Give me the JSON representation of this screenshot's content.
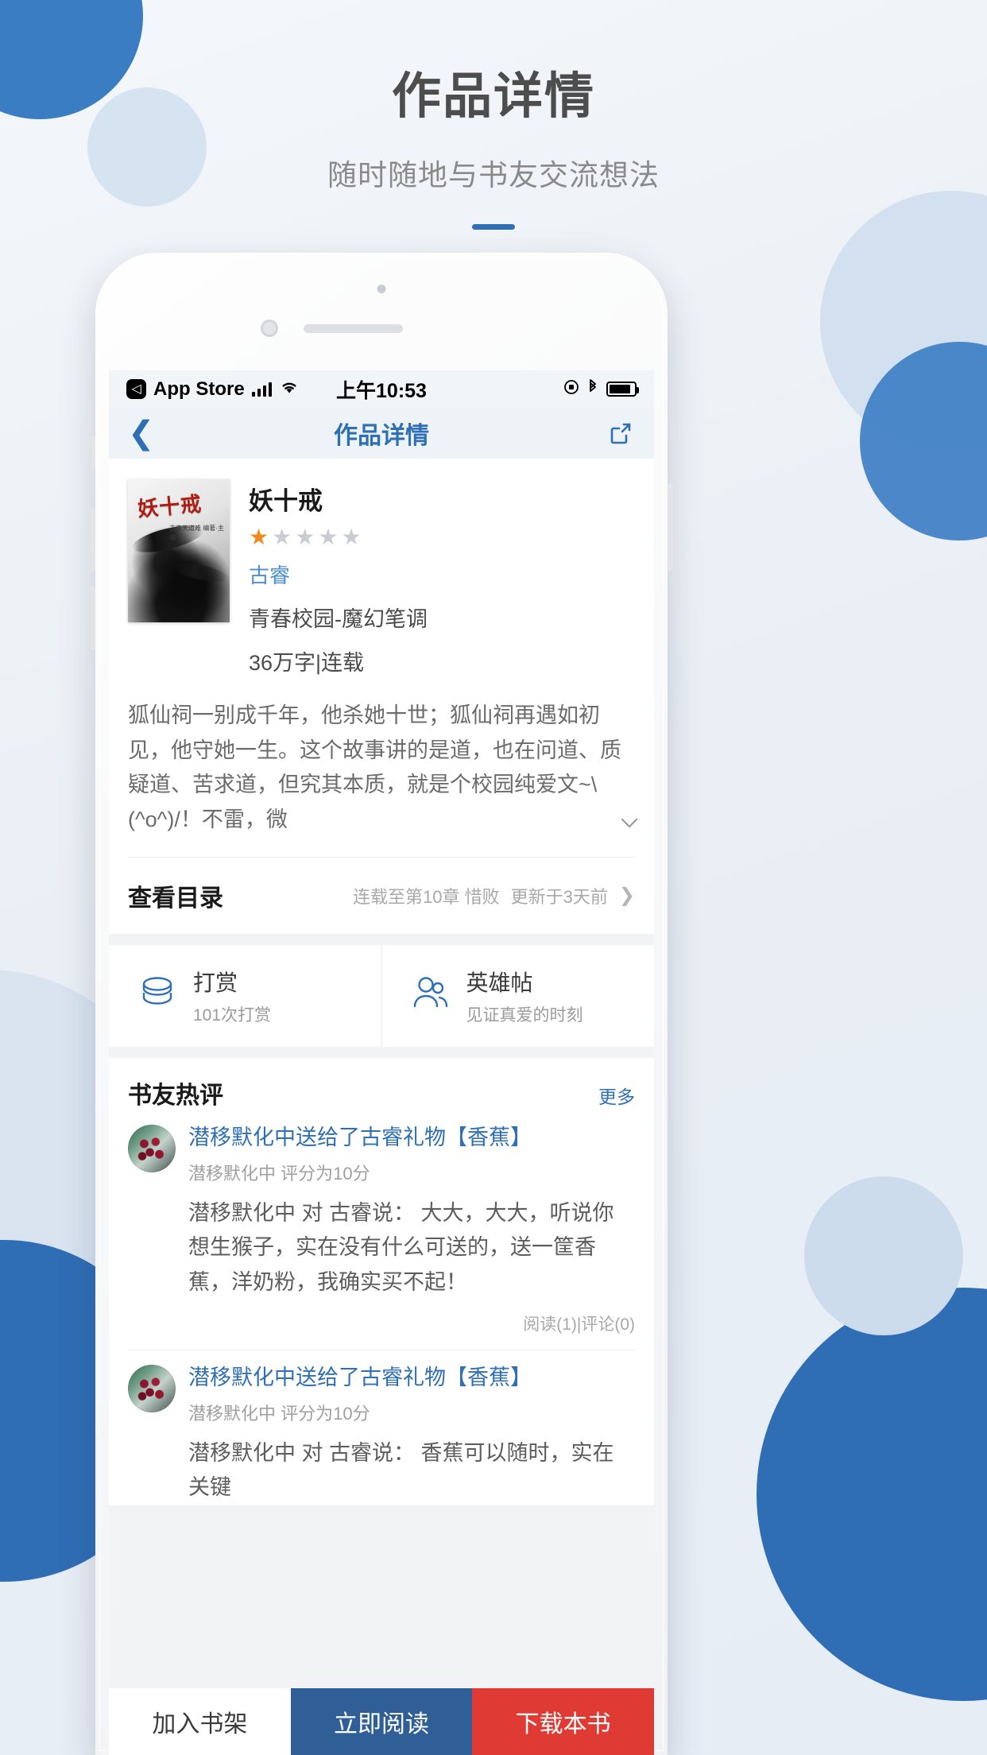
{
  "promo": {
    "headline": "作品详情",
    "subhead": "随时随地与书友交流想法"
  },
  "statusbar": {
    "back_app": "App Store",
    "time": "上午10:53",
    "signal_icon": "cellular-bars-icon",
    "wifi_icon": "wifi-icon",
    "rotation_icon": "rotation-lock-icon",
    "bluetooth_icon": "bluetooth-icon",
    "battery_icon": "battery-icon"
  },
  "navbar": {
    "back_icon": "chevron-left-icon",
    "title": "作品详情",
    "share_icon": "share-external-icon"
  },
  "book": {
    "cover_title": "妖十戒",
    "cover_sub": "古来天道难\n编著·主编",
    "title": "妖十戒",
    "rating_filled": 1,
    "rating_total": 5,
    "star_on_color": "#f08a1c",
    "star_off_color": "#c9cdd2",
    "author": "古睿",
    "genre": "青春校园-魔幻笔调",
    "words_status": "36万字|连载",
    "description": "狐仙祠一别成千年，他杀她十世；狐仙祠再遇如初见，他守她一生。这个故事讲的是道，也在问道、质疑道、苦求道，但究其本质，就是个校园纯爱文~\\(^o^)/！不雷，微",
    "expand_icon": "chevron-down-icon"
  },
  "catalog": {
    "label": "查看目录",
    "chapter": "连载至第10章 惜败",
    "updated": "更新于3天前",
    "arrow_icon": "chevron-right-icon"
  },
  "actions": [
    {
      "icon": "coins-stack-icon",
      "title": "打赏",
      "subtitle": "101次打赏"
    },
    {
      "icon": "two-people-icon",
      "title": "英雄帖",
      "subtitle": "见证真爱的时刻"
    }
  ],
  "comments": {
    "title": "书友热评",
    "more": "更多",
    "items": [
      {
        "avatar_icon": "user-avatar-fruit-icon",
        "title": "潜移默化中送给了古睿礼物【香蕉】",
        "sub": "潜移默化中  评分为10分",
        "text": "潜移默化中 对 古睿说：  大大，大大，听说你想生猴子，实在没有什么可送的，送一筐香蕉，洋奶粉，我确实买不起！",
        "stats": "阅读(1)|评论(0)"
      },
      {
        "avatar_icon": "user-avatar-fruit-icon",
        "title": "潜移默化中送给了古睿礼物【香蕉】",
        "sub": "潜移默化中  评分为10分",
        "text": "潜移默化中 对 古睿说：  香蕉可以随时，实在 关键",
        "stats": ""
      }
    ]
  },
  "bottombar": {
    "shelf": "加入书架",
    "read": "立即阅读",
    "download": "下载本书",
    "read_color": "#2f5f96",
    "download_color": "#e03a35"
  }
}
